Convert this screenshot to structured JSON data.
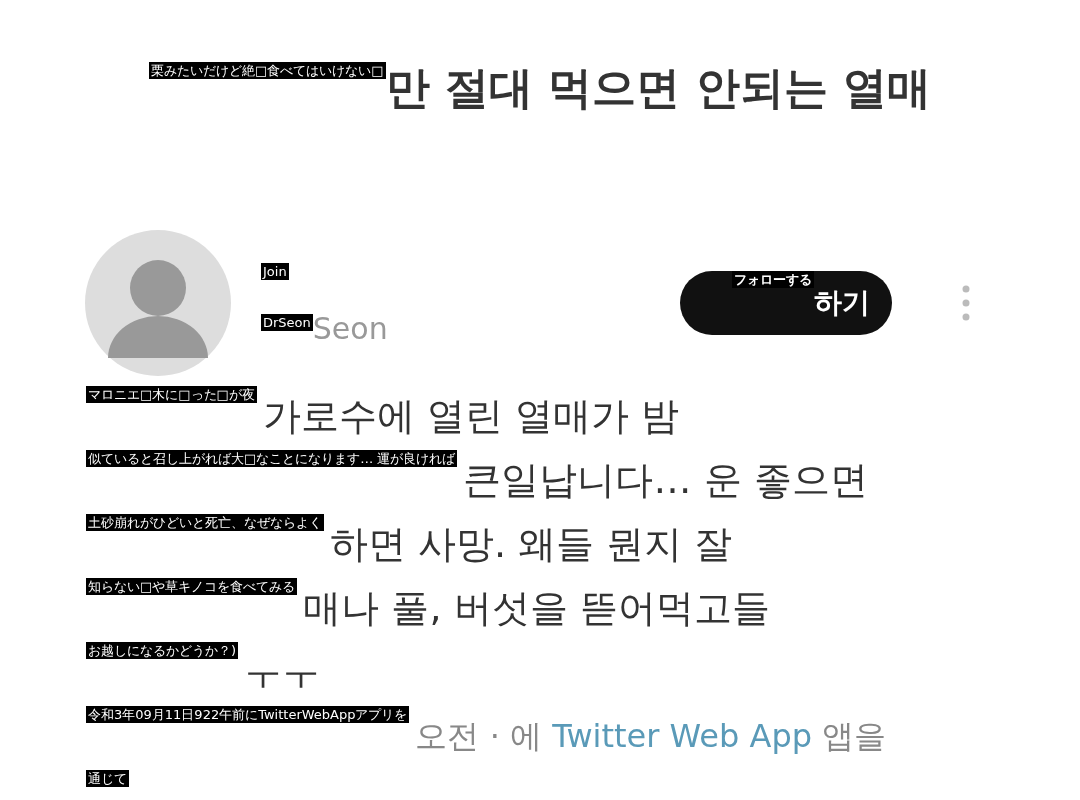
{
  "title": {
    "overlay": "栗みたいだけど絶□食べてはいけない□",
    "text": "만 절대 먹으면 안되는 열매"
  },
  "author": {
    "name_overlay": "Join",
    "handle_overlay": "DrSeon",
    "handle": "Seon"
  },
  "follow_button": {
    "overlay": "フォローする",
    "text": "하기"
  },
  "lines": [
    {
      "kind": "text",
      "overlay": "マロニエ□木に□った□が夜",
      "text": "가로수에 열린 열매가 밤"
    },
    {
      "kind": "text",
      "overlay": "似ていると召し上がれば大□なことになります… 運が良ければ",
      "text": "큰일납니다… 운 좋으면"
    },
    {
      "kind": "text",
      "overlay": "土砂崩れがひどいと死亡、なぜならよく",
      "text": "하면 사망. 왜들 뭔지 잘"
    },
    {
      "kind": "text",
      "overlay": "知らない□や草キノコを食べてみる",
      "text": "매나 풀, 버섯을 뜯어먹고들"
    },
    {
      "kind": "text",
      "overlay": "お越しになるかどうか？)",
      "text": "ㅜㅜ"
    },
    {
      "kind": "source",
      "overlay": "令和3年09月11日922午前にTwitterWebAppアプリを",
      "text": "오전 · 에",
      "link": "Twitter Web App",
      "suffix": "앱을"
    },
    {
      "kind": "overlay",
      "overlay": "通じて"
    }
  ]
}
